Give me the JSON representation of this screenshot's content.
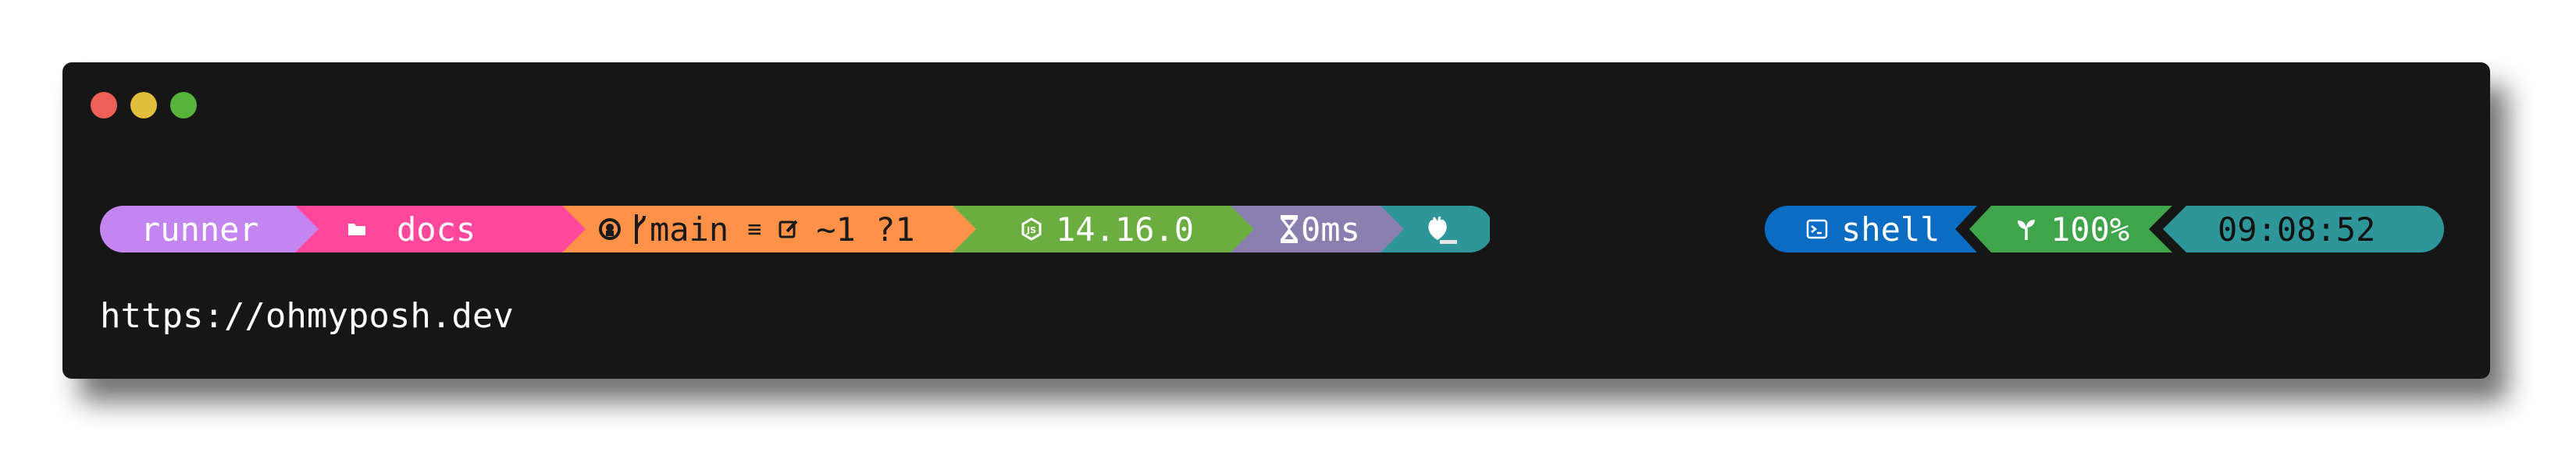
{
  "window": {
    "controls": [
      "close",
      "minimize",
      "maximize"
    ]
  },
  "left_prompt": {
    "segments": [
      {
        "name": "session",
        "text": "runner",
        "color": "#c386f1"
      },
      {
        "name": "path",
        "icon": "folder-icon",
        "text": "docs",
        "color": "#ff479c"
      },
      {
        "name": "git",
        "icon": "github-icon",
        "branch_icon": "git-branch-icon",
        "text": "main",
        "status": "≡",
        "working_icon": "edit-icon",
        "working": "~1 ?1",
        "color": "#ff9248"
      },
      {
        "name": "node",
        "icon": "node-icon",
        "text": "14.16.0",
        "color": "#6cad42"
      },
      {
        "name": "execution-time",
        "icon": "hourglass-icon",
        "text": "0ms",
        "color": "#8b7fb0"
      },
      {
        "name": "exit-status",
        "icon": "heart-icon",
        "color": "#2e9599"
      }
    ],
    "cursor": "_"
  },
  "right_prompt": {
    "segments": [
      {
        "name": "shell",
        "icon": "terminal-icon",
        "text": "shell",
        "color": "#0077c2"
      },
      {
        "name": "battery",
        "icon": "sprout-icon",
        "text": "100%",
        "color": "#40c4ff"
      },
      {
        "name": "time",
        "text": "09:08:52",
        "color": "#2e9599"
      }
    ]
  },
  "output_line": "https://ohmyposh.dev"
}
